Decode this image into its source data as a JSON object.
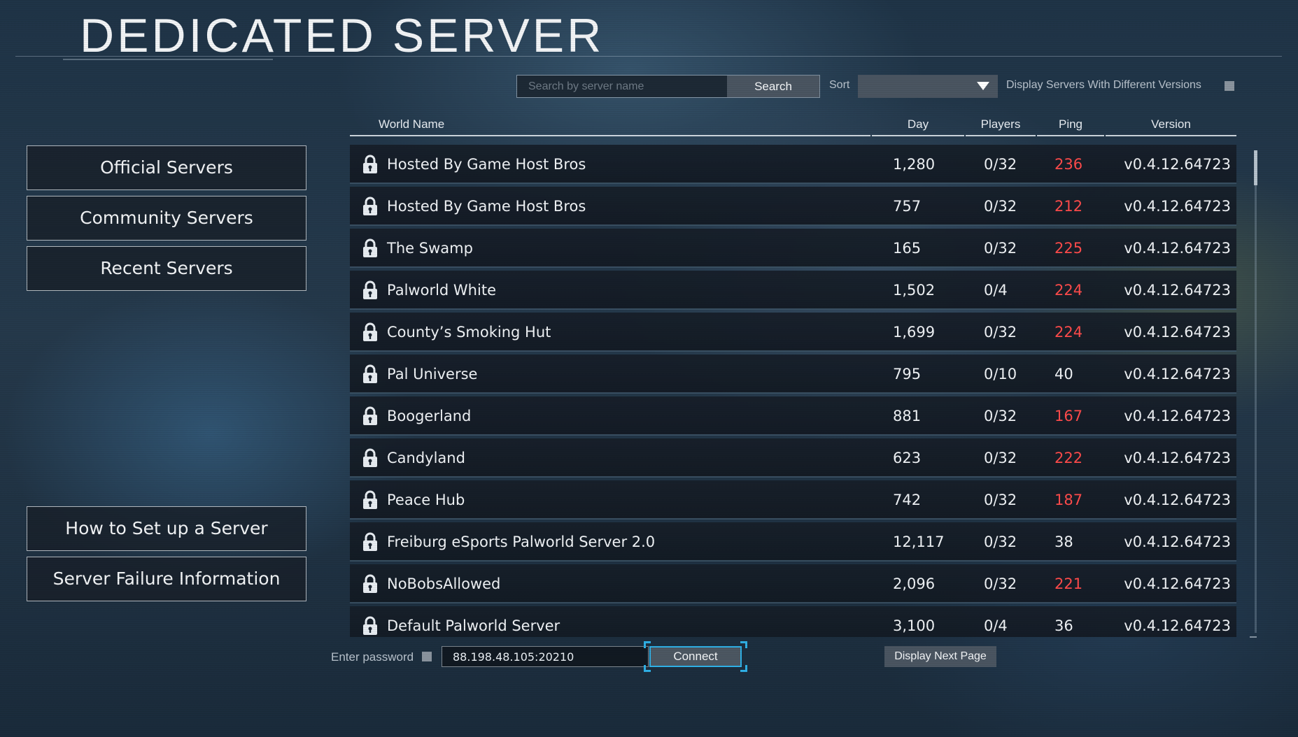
{
  "header": {
    "title": "DEDICATED SERVER"
  },
  "search": {
    "placeholder": "Search by server name",
    "button_label": "Search"
  },
  "sort": {
    "label": "Sort",
    "selected": ""
  },
  "versions_toggle": {
    "label": "Display Servers With Different Versions",
    "checked": false
  },
  "sidebar": {
    "top_items": [
      {
        "label": "Official Servers"
      },
      {
        "label": "Community Servers"
      },
      {
        "label": "Recent Servers"
      }
    ],
    "bottom_items": [
      {
        "label": "How to Set up a Server"
      },
      {
        "label": "Server Failure Information"
      }
    ]
  },
  "table": {
    "columns": [
      "World Name",
      "Day",
      "Players",
      "Ping",
      "Version"
    ],
    "rows": [
      {
        "name": "Hosted By Game Host Bros",
        "day": "1,280",
        "players": "0/32",
        "ping": "236",
        "ping_high": true,
        "version": "v0.4.12.64723",
        "locked": true
      },
      {
        "name": "Hosted By Game Host Bros",
        "day": "757",
        "players": "0/32",
        "ping": "212",
        "ping_high": true,
        "version": "v0.4.12.64723",
        "locked": true
      },
      {
        "name": "The Swamp",
        "day": "165",
        "players": "0/32",
        "ping": "225",
        "ping_high": true,
        "version": "v0.4.12.64723",
        "locked": true
      },
      {
        "name": "Palworld White",
        "day": "1,502",
        "players": "0/4",
        "ping": "224",
        "ping_high": true,
        "version": "v0.4.12.64723",
        "locked": true
      },
      {
        "name": "County’s Smoking Hut",
        "day": "1,699",
        "players": "0/32",
        "ping": "224",
        "ping_high": true,
        "version": "v0.4.12.64723",
        "locked": true
      },
      {
        "name": "Pal Universe",
        "day": "795",
        "players": "0/10",
        "ping": "40",
        "ping_high": false,
        "version": "v0.4.12.64723",
        "locked": true
      },
      {
        "name": "Boogerland",
        "day": "881",
        "players": "0/32",
        "ping": "167",
        "ping_high": true,
        "version": "v0.4.12.64723",
        "locked": true
      },
      {
        "name": "Candyland",
        "day": "623",
        "players": "0/32",
        "ping": "222",
        "ping_high": true,
        "version": "v0.4.12.64723",
        "locked": true
      },
      {
        "name": "Peace Hub",
        "day": "742",
        "players": "0/32",
        "ping": "187",
        "ping_high": true,
        "version": "v0.4.12.64723",
        "locked": true
      },
      {
        "name": "Freiburg eSports Palworld Server 2.0",
        "day": "12,117",
        "players": "0/32",
        "ping": "38",
        "ping_high": false,
        "version": "v0.4.12.64723",
        "locked": true
      },
      {
        "name": "NoBobsAllowed",
        "day": "2,096",
        "players": "0/32",
        "ping": "221",
        "ping_high": true,
        "version": "v0.4.12.64723",
        "locked": true
      },
      {
        "name": "Default Palworld Server",
        "day": "3,100",
        "players": "0/4",
        "ping": "36",
        "ping_high": false,
        "version": "v0.4.12.64723",
        "locked": true
      }
    ]
  },
  "footer": {
    "password_label": "Enter password",
    "password_checked": false,
    "ip_value": "88.198.48.105:20210",
    "connect_label": "Connect",
    "next_page_label": "Display Next Page"
  },
  "colors": {
    "ping_high": "#ff4b4b",
    "focus_accent": "#2fb0e6"
  },
  "icons": {
    "row_icon": "lock-icon",
    "sort_icon": "chevron-down-icon"
  }
}
